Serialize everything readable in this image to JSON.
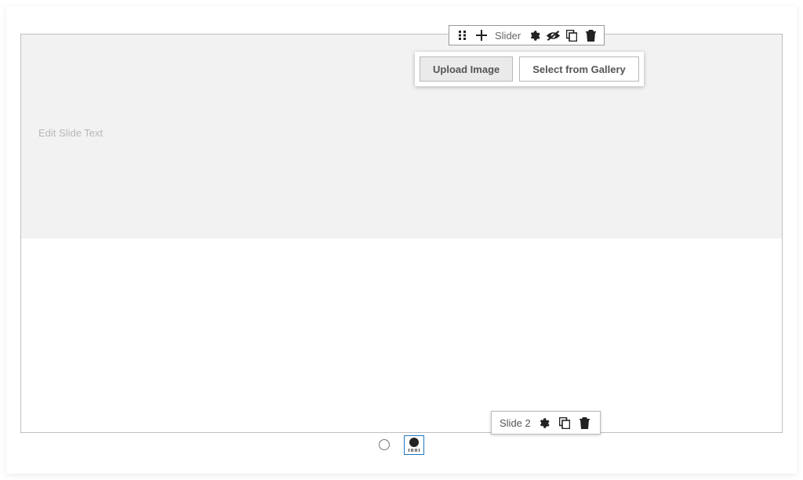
{
  "toolbar": {
    "component_label": "Slider"
  },
  "actions": {
    "upload_label": "Upload Image",
    "gallery_label": "Select from Gallery"
  },
  "slide": {
    "placeholder_text": "Edit Slide Text"
  },
  "slide_popup": {
    "label": "Slide 2"
  },
  "indicators": {
    "count": 2,
    "active_index": 1
  }
}
